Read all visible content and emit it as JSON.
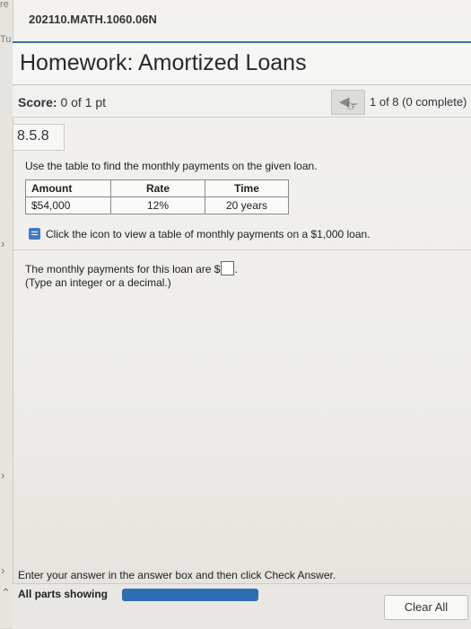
{
  "edge": {
    "top_fragment": "re",
    "tab_fragment": "Tu"
  },
  "course": {
    "id": "202110.MATH.1060.06N"
  },
  "homework": {
    "title": "Homework: Amortized Loans"
  },
  "score": {
    "label": "Score:",
    "value": "0 of 1 pt",
    "progress_text": "1 of 8 (0 complete)"
  },
  "question": {
    "number": "8.5.8",
    "prompt": "Use the table to find the monthly payments on the given loan.",
    "table": {
      "headers": [
        "Amount",
        "Rate",
        "Time"
      ],
      "row": [
        "$54,000",
        "12%",
        "20 years"
      ]
    },
    "info_link": "Click the icon to view a table of monthly payments on a $1,000 loan.",
    "answer_prefix": "The monthly payments for this loan are $",
    "answer_suffix": ".",
    "answer_hint": "(Type an integer or a decimal.)"
  },
  "footer": {
    "instruction": "Enter your answer in the answer box and then click Check Answer.",
    "all_parts": "All parts showing",
    "clear_all": "Clear All"
  },
  "colors": {
    "accent": "#3b6ea5",
    "progress_fill": "#2f6db3",
    "info_icon": "#3f7cc4"
  }
}
